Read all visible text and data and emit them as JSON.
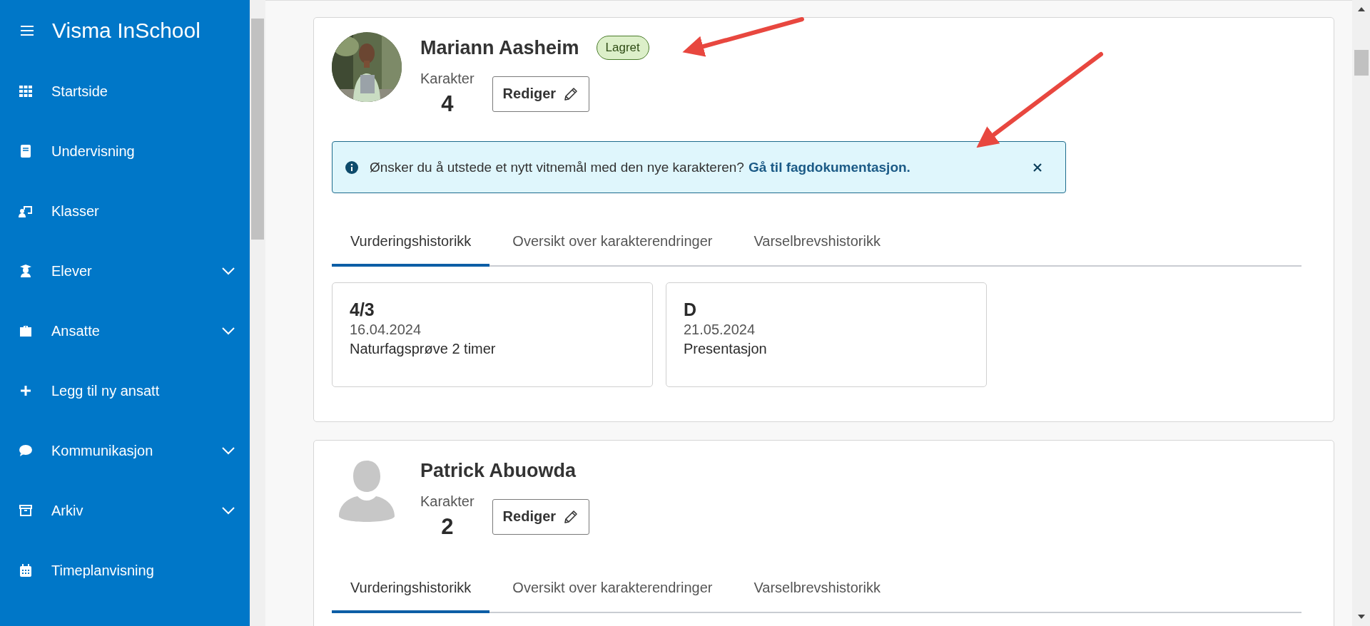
{
  "app": {
    "title": "Visma InSchool"
  },
  "sidebar": {
    "items": [
      {
        "label": "Startside",
        "has_submenu": false
      },
      {
        "label": "Undervisning",
        "has_submenu": false
      },
      {
        "label": "Klasser",
        "has_submenu": false
      },
      {
        "label": "Elever",
        "has_submenu": true
      },
      {
        "label": "Ansatte",
        "has_submenu": true
      },
      {
        "label": "Legg til ny ansatt",
        "has_submenu": false
      },
      {
        "label": "Kommunikasjon",
        "has_submenu": true
      },
      {
        "label": "Arkiv",
        "has_submenu": true
      },
      {
        "label": "Timeplanvisning",
        "has_submenu": false
      }
    ]
  },
  "students": [
    {
      "name": "Mariann Aasheim",
      "avatar": {
        "kind": "picture"
      },
      "badge": "Lagret",
      "grade_label": "Karakter",
      "grade": "4",
      "edit_button": "Rediger",
      "alert": {
        "text": "Ønsker du å utstede et nytt vitnemål med den nye karakteren?",
        "link": "Gå til fagdokumentasjon."
      },
      "tabs": [
        {
          "label": "Vurderingshistorikk",
          "selected": true
        },
        {
          "label": "Oversikt over karakterendringer",
          "selected": false
        },
        {
          "label": "Varselbrevshistorikk",
          "selected": false
        }
      ],
      "assessments": [
        {
          "grade": "4/3",
          "date": "16.04.2024",
          "title": "Naturfagsprøve 2 timer"
        },
        {
          "grade": "D",
          "date": "21.05.2024",
          "title": "Presentasjon"
        }
      ]
    },
    {
      "name": "Patrick Abuowda",
      "avatar": {
        "kind": "placeholder"
      },
      "grade_label": "Karakter",
      "grade": "2",
      "edit_button": "Rediger",
      "tabs": [
        {
          "label": "Vurderingshistorikk",
          "selected": true
        },
        {
          "label": "Oversikt over karakterendringer",
          "selected": false
        },
        {
          "label": "Varselbrevshistorikk",
          "selected": false
        }
      ]
    }
  ]
}
